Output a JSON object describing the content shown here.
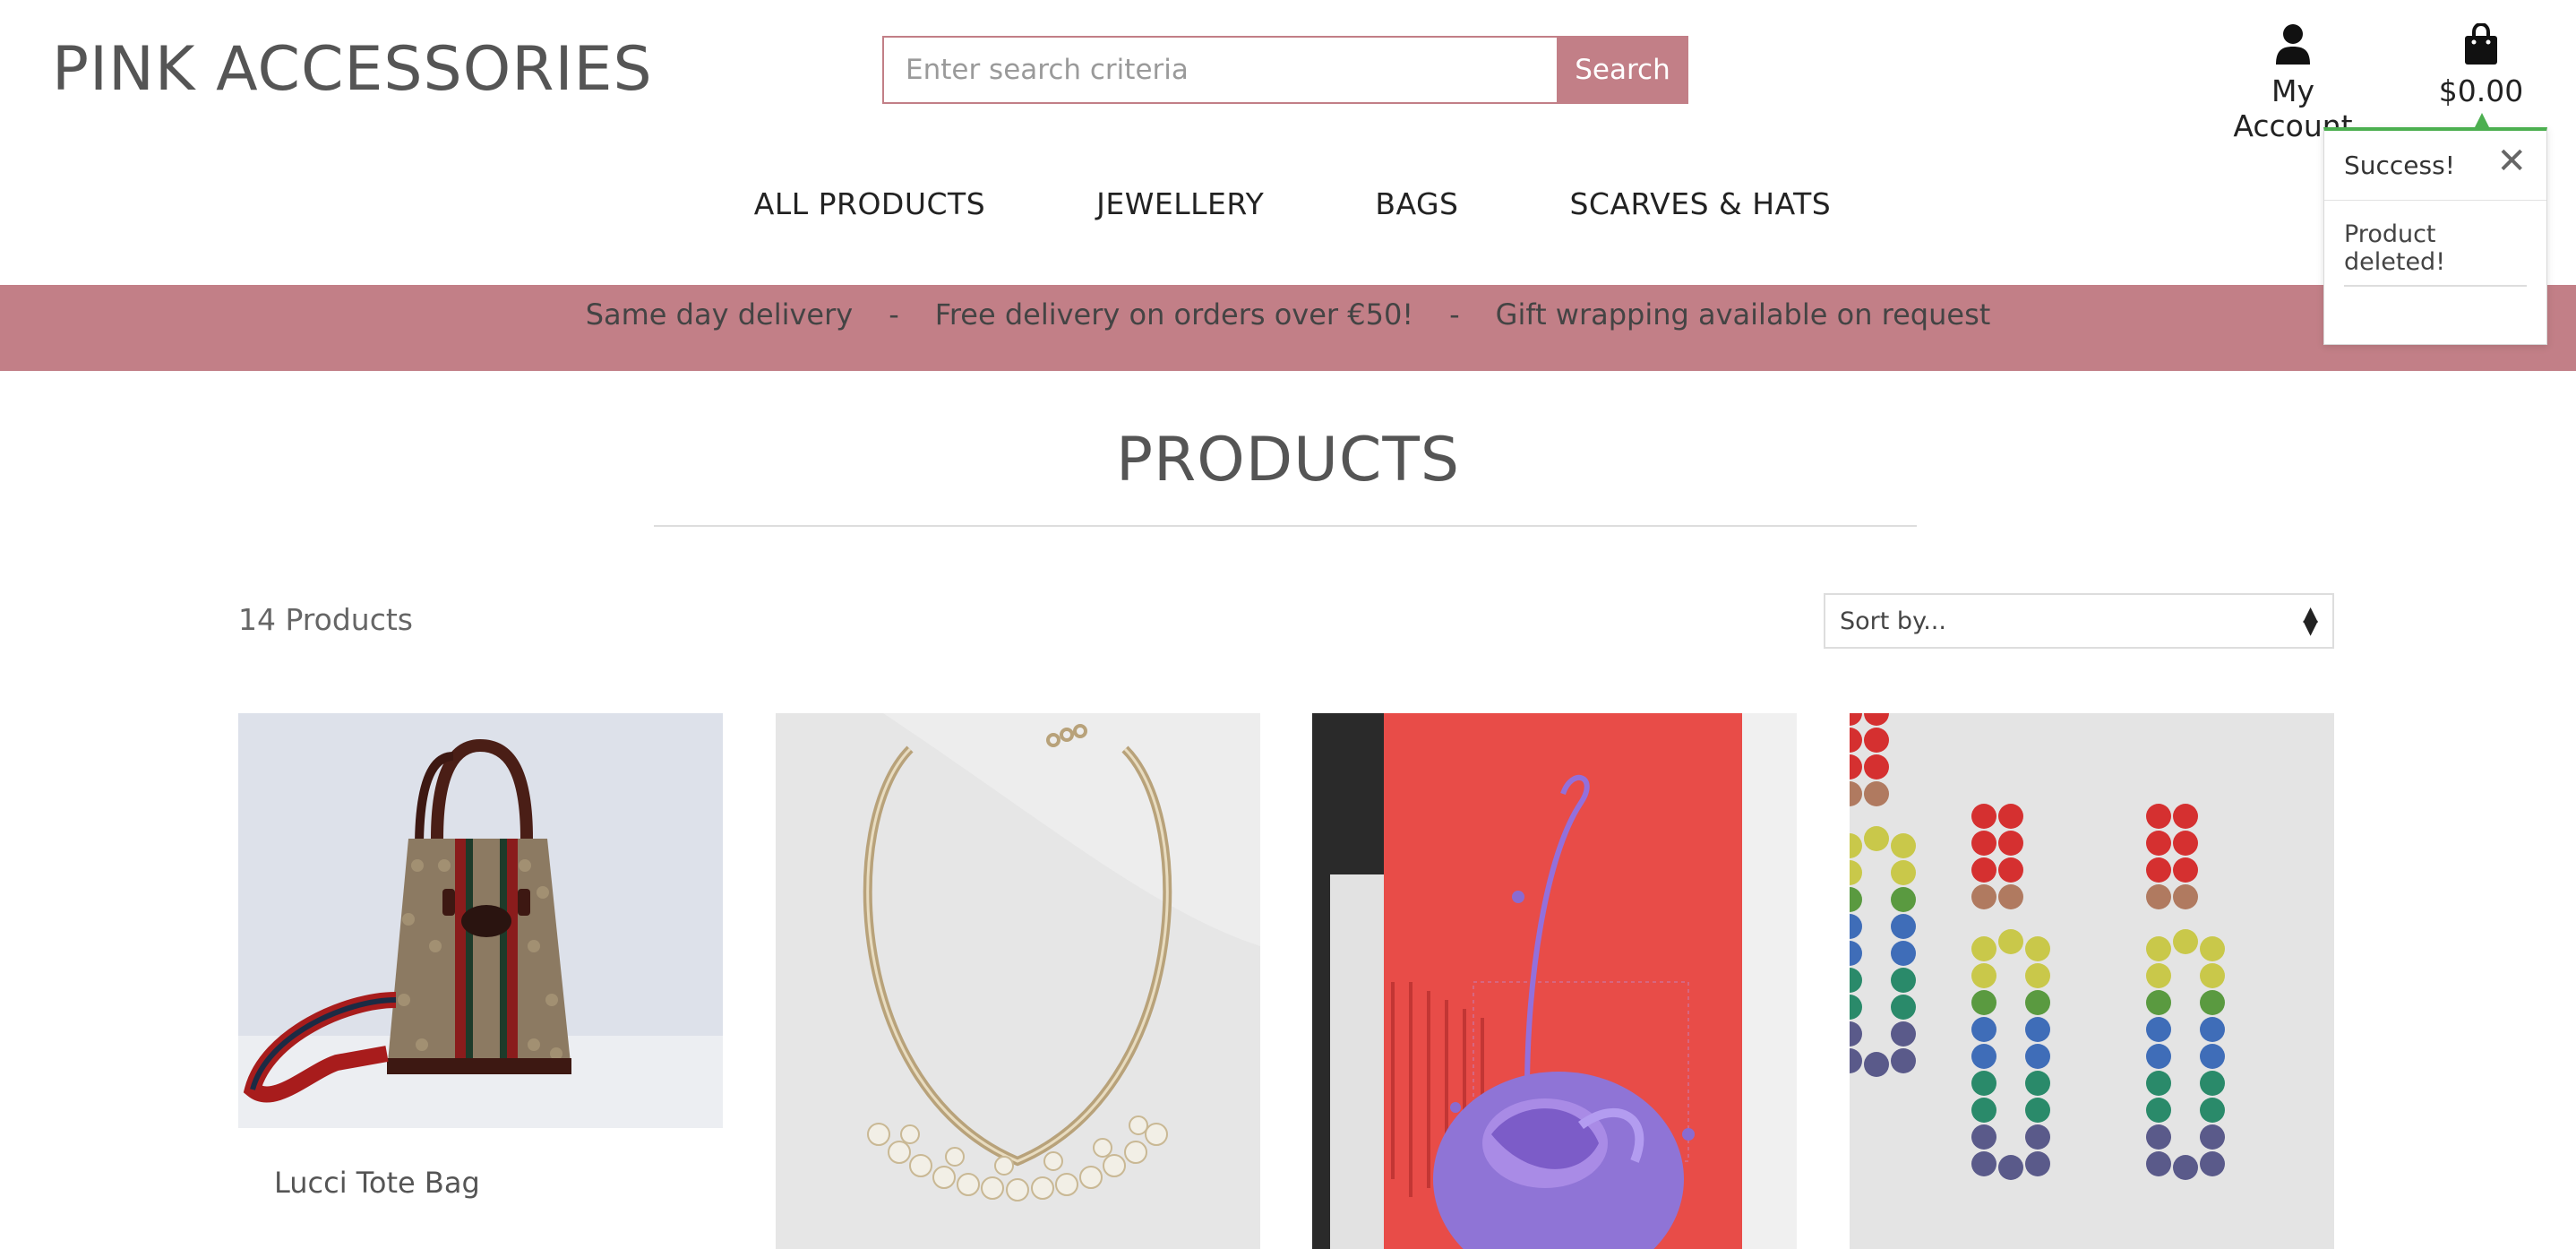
{
  "header": {
    "brand": "PINK ACCESSORIES",
    "search_placeholder": "Enter search criteria",
    "search_button": "Search",
    "account_label": "My Account",
    "cart_total": "$0.00"
  },
  "nav": [
    "ALL PRODUCTS",
    "JEWELLERY",
    "BAGS",
    "SCARVES & HATS"
  ],
  "banner": {
    "items": [
      "Same day delivery",
      "Free delivery on orders over €50!",
      "Gift wrapping available on request"
    ],
    "separator": "-"
  },
  "toast": {
    "title": "Success!",
    "message": "Product deleted!"
  },
  "main": {
    "title": "PRODUCTS",
    "product_count": "14 Products",
    "sort_label": "Sort by..."
  },
  "products": [
    {
      "name": "Lucci Tote Bag"
    },
    {
      "name": ""
    },
    {
      "name": ""
    },
    {
      "name": ""
    }
  ],
  "colors": {
    "accent": "#c27f87",
    "success": "#4caf50"
  }
}
